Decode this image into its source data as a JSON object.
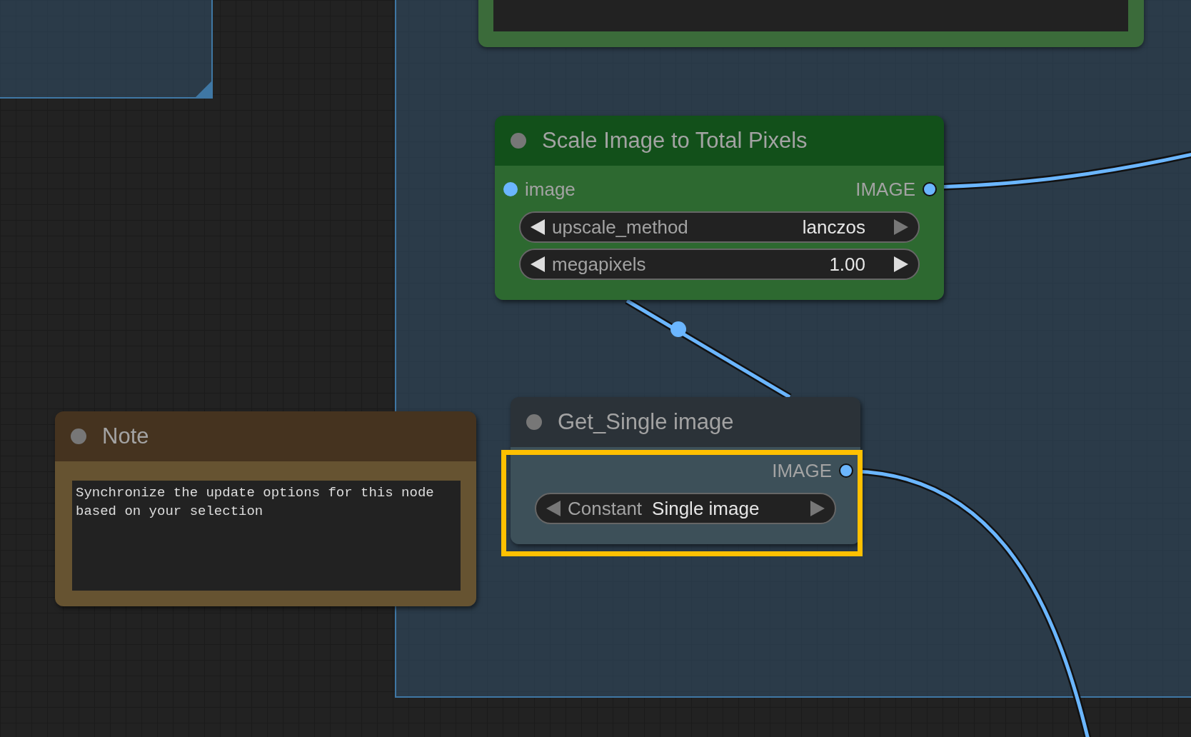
{
  "nodes": [
    {
      "kind": "process",
      "title": "Scale Image to Total Pixels",
      "selected": false,
      "inputs": [
        "image"
      ],
      "outputs": [
        "IMAGE"
      ],
      "widgets": [
        {
          "label": "upscale_method",
          "value": "lanczos",
          "prev_enabled": true,
          "next_enabled": false
        },
        {
          "label": "megapixels",
          "value": "1.00",
          "prev_enabled": true,
          "next_enabled": true
        }
      ]
    },
    {
      "kind": "note",
      "title": "Note",
      "selected": false,
      "text": "Synchronize the update options for this node\nbased on your selection"
    },
    {
      "kind": "process",
      "title": "Get_Single image",
      "selected": true,
      "outputs": [
        "IMAGE"
      ],
      "widgets": [
        {
          "label": "Constant",
          "value": "Single image",
          "prev_enabled": false,
          "next_enabled": false
        }
      ]
    }
  ]
}
